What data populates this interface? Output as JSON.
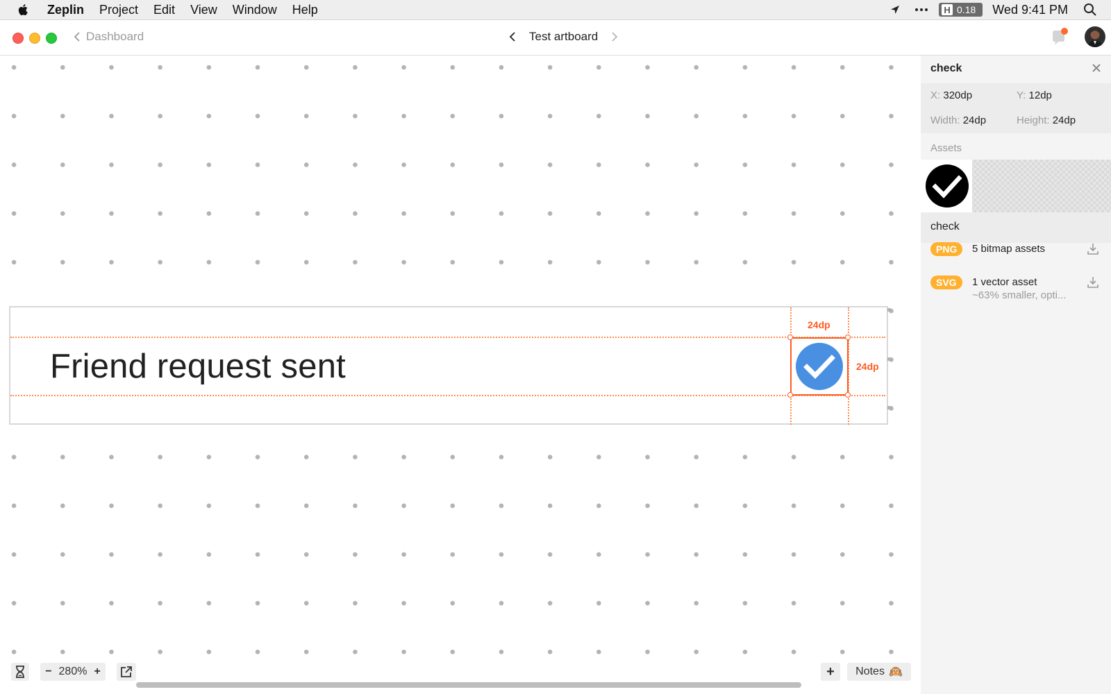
{
  "menubar": {
    "app": "Zeplin",
    "items": [
      "Project",
      "Edit",
      "View",
      "Window",
      "Help"
    ],
    "badge_letter": "H",
    "badge_value": "0.18",
    "clock": "Wed 9:41 PM"
  },
  "titlebar": {
    "back_label": "Dashboard",
    "artboard_title": "Test artboard"
  },
  "canvas": {
    "text": "Friend request sent",
    "width_label": "24dp",
    "height_label": "24dp"
  },
  "bottom": {
    "zoom": "280%",
    "minus": "−",
    "plus": "+",
    "add": "+",
    "notes": "Notes",
    "notes_emoji": "🙉"
  },
  "panel": {
    "title": "check",
    "x_key": "X:",
    "x_val": "320dp",
    "y_key": "Y:",
    "y_val": "12dp",
    "w_key": "Width:",
    "w_val": "24dp",
    "h_key": "Height:",
    "h_val": "24dp",
    "assets_heading": "Assets",
    "asset_name": "check",
    "exports": [
      {
        "format": "PNG",
        "label": "5 bitmap assets",
        "sub": ""
      },
      {
        "format": "SVG",
        "label": "1 vector asset",
        "sub": "~63% smaller, opti..."
      }
    ]
  },
  "colors": {
    "accent": "#ff5b1f",
    "check_blue": "#4a90e2",
    "format_badge": "#ffb02e"
  }
}
